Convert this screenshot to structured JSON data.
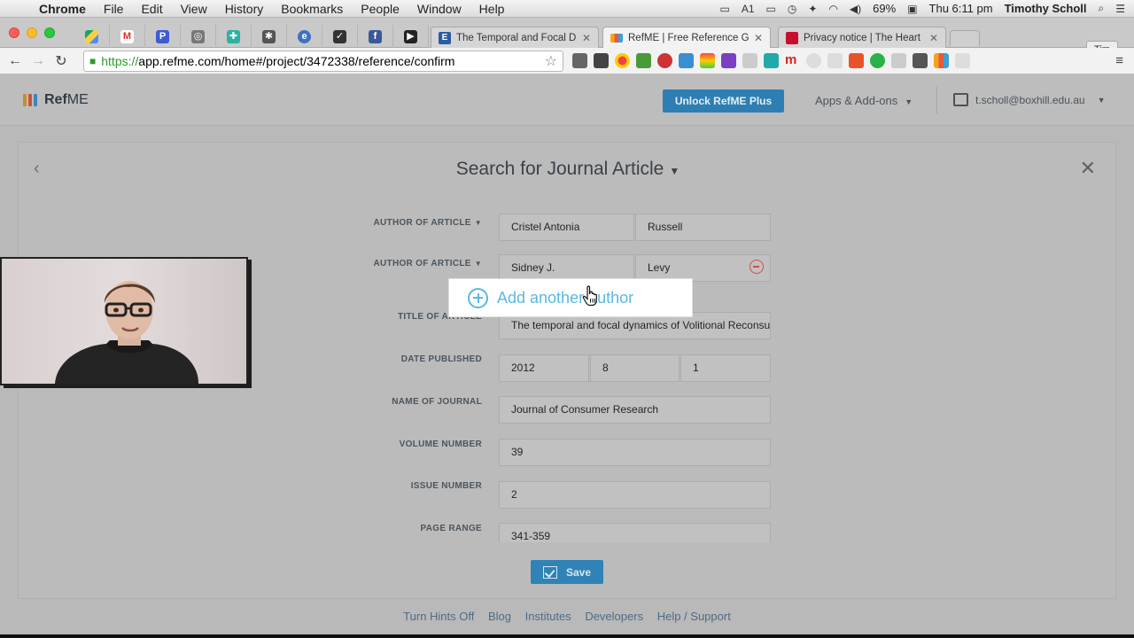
{
  "menubar": {
    "app": "Chrome",
    "items": [
      "File",
      "Edit",
      "View",
      "History",
      "Bookmarks",
      "People",
      "Window",
      "Help"
    ],
    "battery": "69%",
    "clock": "Thu 6:11 pm",
    "user": "Timothy Scholl",
    "status_icons": [
      "screen-icon",
      "adobe-icon",
      "airplay-icon",
      "time-machine-icon",
      "bluetooth-icon",
      "wifi-icon",
      "volume-icon"
    ]
  },
  "tabs": {
    "pinned_icons": [
      "google-drive-icon",
      "gmail-icon",
      "pocket-icon",
      "camera-icon",
      "app-icon",
      "settings-icon",
      "evernote-icon",
      "bookmark-icon",
      "facebook-icon",
      "video-icon"
    ],
    "items": [
      {
        "label": "The Temporal and Focal D",
        "favicon": "E",
        "active": false
      },
      {
        "label": "RefME | Free Reference Ge",
        "favicon": "refme",
        "active": true
      },
      {
        "label": "Privacy notice | The Heart",
        "favicon": "heart",
        "active": false
      }
    ],
    "profile": "Tim"
  },
  "toolbar": {
    "url_scheme": "https://",
    "url_rest": "app.refme.com/home#/project/3472338/reference/confirm"
  },
  "app": {
    "logo_bold": "Ref",
    "logo_rest": "ME",
    "unlock_label": "Unlock RefME Plus",
    "apps_label": "Apps & Add-ons",
    "user_email": "t.scholl@boxhill.edu.au"
  },
  "form": {
    "title": "Search for Journal Article",
    "author_label": "AUTHOR OF ARTICLE",
    "author1_first": "Cristel Antonia",
    "author1_last": "Russell",
    "author2_first": "Sidney J.",
    "author2_last": "Levy",
    "add_author": "Add another author",
    "title_label": "TITLE OF ARTICLE",
    "title_value": "The temporal and focal dynamics of Volitional Reconsumption",
    "date_label": "DATE PUBLISHED",
    "date_year": "2012",
    "date_month": "8",
    "date_day": "1",
    "journal_label": "NAME OF JOURNAL",
    "journal_value": "Journal of Consumer Research",
    "volume_label": "VOLUME NUMBER",
    "volume_value": "39",
    "issue_label": "ISSUE NUMBER",
    "issue_value": "2",
    "pages_label": "PAGE RANGE",
    "pages_value": "341-359",
    "save_label": "Save"
  },
  "footer": {
    "links": [
      "Turn Hints Off",
      "Blog",
      "Institutes",
      "Developers",
      "Help / Support"
    ]
  },
  "colors": {
    "accent": "#2f83b6",
    "hint": "#5bb8e2",
    "remove": "#d64b4b"
  }
}
